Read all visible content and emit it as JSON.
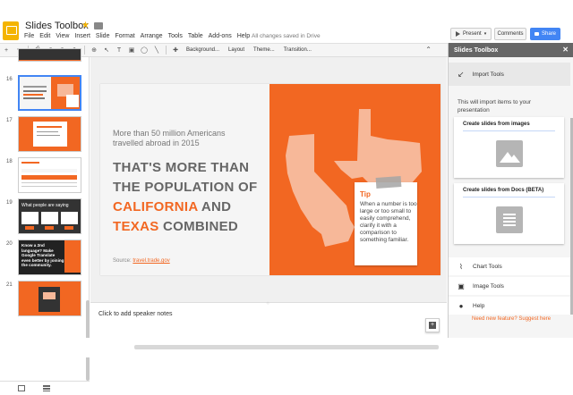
{
  "app": {
    "title": "Slides Toolbox",
    "star_glyph": "★",
    "autosave": "All changes saved in Drive",
    "menu": [
      "File",
      "Edit",
      "View",
      "Insert",
      "Slide",
      "Format",
      "Arrange",
      "Tools",
      "Table",
      "Add-ons",
      "Help"
    ],
    "present_label": "Present",
    "comments_label": "Comments",
    "share_label": "Share"
  },
  "toolbar": {
    "background_label": "Background...",
    "layout_label": "Layout",
    "theme_label": "Theme...",
    "transition_label": "Transition..."
  },
  "filmstrip": {
    "thumbs": [
      {
        "num": "16"
      },
      {
        "num": "17"
      },
      {
        "num": "18"
      },
      {
        "num": "19"
      },
      {
        "num": "20"
      },
      {
        "num": "21"
      }
    ],
    "t19_title": "What people are saying",
    "t20_title": "Know a 2nd language? Make Google Translate even better by joining the community.",
    "t20_highlight": "community"
  },
  "slide": {
    "stat": "More than 50 million Americans travelled abroad in 2015",
    "headline_1": "THAT'S MORE THAN THE POPULATION OF",
    "headline_california": "CALIFORNIA",
    "headline_and": "AND",
    "headline_texas": "TEXAS",
    "headline_combined": "COMBINED",
    "source_label": "Source:",
    "source_link": "travel.trade.gov",
    "tip_title": "Tip",
    "tip_body": "When a number is too large or too small to easily comprehend, clarify it with a comparison to something familiar."
  },
  "notes": {
    "placeholder": "Click to add speaker notes"
  },
  "panel": {
    "title": "Slides Toolbox",
    "import_label": "Import Tools",
    "description": "This will import items to your presentation",
    "card1_title": "Create slides from images",
    "card2_title": "Create slides from Docs (BETA)",
    "chart_tools": "Chart Tools",
    "image_tools": "Image Tools",
    "help": "Help",
    "suggest": "Need new feature? Suggest here"
  },
  "colors": {
    "orange": "#f26722",
    "share_blue": "#4285f4",
    "panel_header": "#666666"
  }
}
